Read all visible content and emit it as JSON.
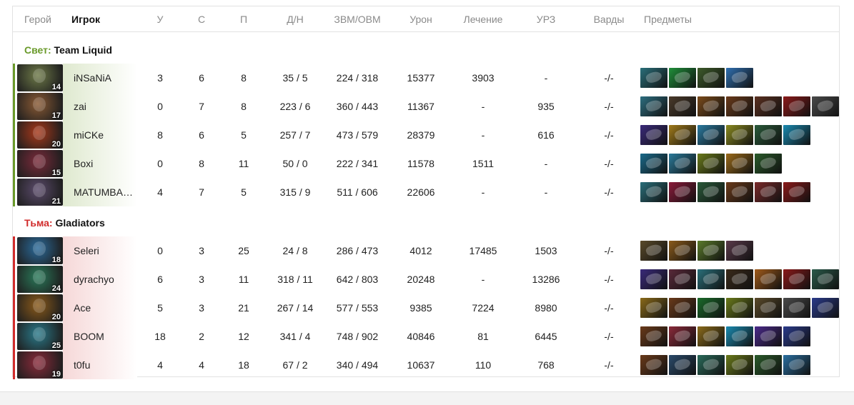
{
  "headers": {
    "hero": "Герой",
    "player": "Игрок",
    "kills": "У",
    "deaths": "С",
    "assists": "П",
    "lh_dn": "Д/Н",
    "gpm_xpm": "ЗВМ/ОВМ",
    "damage": "Урон",
    "healing": "Лечение",
    "tower_damage": "УРЗ",
    "wards": "Варды",
    "items": "Предметы"
  },
  "teams": [
    {
      "side": "Свет:",
      "name": "Team Liquid",
      "players": [
        {
          "level": "14",
          "name": "iNSaNiA",
          "k": "3",
          "d": "6",
          "a": "8",
          "lhdn": "35 / 5",
          "gx": "224 / 318",
          "dmg": "15377",
          "heal": "3903",
          "td": "-",
          "wards": "-/-",
          "hero_color": "#6e7a48",
          "items": [
            "#2a6f7a",
            "#1f8f3a",
            "#3d5a2a",
            "#2f6fb0"
          ]
        },
        {
          "level": "17",
          "name": "zai",
          "k": "0",
          "d": "7",
          "a": "8",
          "lhdn": "223 / 6",
          "gx": "360 / 443",
          "dmg": "11367",
          "heal": "-",
          "td": "935",
          "wards": "-/-",
          "hero_color": "#8a5a34",
          "items": [
            "#2d6e80",
            "#4a3a2a",
            "#7a4a1a",
            "#6a3a1a",
            "#5a3020",
            "#8a1a1a",
            "#4a4a4a"
          ]
        },
        {
          "level": "20",
          "name": "miCKe",
          "k": "8",
          "d": "6",
          "a": "5",
          "lhdn": "257 / 7",
          "gx": "473 / 579",
          "dmg": "28379",
          "heal": "-",
          "td": "616",
          "wards": "-/-",
          "hero_color": "#a8381a",
          "items": [
            "#3a2a7a",
            "#a07a1a",
            "#2a7aa0",
            "#8a8a20",
            "#2a5a3a",
            "#1a8ab0"
          ]
        },
        {
          "level": "15",
          "name": "Boxi",
          "k": "0",
          "d": "8",
          "a": "11",
          "lhdn": "50 / 0",
          "gx": "222 / 341",
          "dmg": "11578",
          "heal": "1511",
          "td": "-",
          "wards": "-/-",
          "hero_color": "#7a2a3a",
          "items": [
            "#1a6a8a",
            "#2a7a9a",
            "#6a7a1a",
            "#9a6a1a",
            "#2a5a2a"
          ]
        },
        {
          "level": "21",
          "name": "MATUMBAM…",
          "k": "4",
          "d": "7",
          "a": "5",
          "lhdn": "315 / 9",
          "gx": "511 / 606",
          "dmg": "22606",
          "heal": "-",
          "td": "-",
          "wards": "-/-",
          "hero_color": "#5a4a6a",
          "items": [
            "#2a6f7a",
            "#8a1a3a",
            "#2a5a3a",
            "#6a3a1a",
            "#7a2a2a",
            "#8a1a1a"
          ]
        }
      ]
    },
    {
      "side": "Тьма:",
      "name": "Gladiators",
      "players": [
        {
          "level": "18",
          "name": "Seleri",
          "k": "0",
          "d": "3",
          "a": "25",
          "lhdn": "24 / 8",
          "gx": "286 / 473",
          "dmg": "4012",
          "heal": "17485",
          "td": "1503",
          "wards": "-/-",
          "hero_color": "#2a6a9a",
          "items": [
            "#5a4a2a",
            "#8a5a1a",
            "#5a7a2a",
            "#5a3a4a"
          ]
        },
        {
          "level": "24",
          "name": "dyrachyo",
          "k": "6",
          "d": "3",
          "a": "11",
          "lhdn": "318 / 11",
          "gx": "642 / 803",
          "dmg": "20248",
          "heal": "-",
          "td": "13286",
          "wards": "-/-",
          "hero_color": "#2a7a5a",
          "items": [
            "#3a2a7a",
            "#5a2a3a",
            "#2a6f7a",
            "#3a2a1a",
            "#a05a1a",
            "#8a1a1a",
            "#2a5a4a"
          ]
        },
        {
          "level": "20",
          "name": "Ace",
          "k": "5",
          "d": "3",
          "a": "21",
          "lhdn": "267 / 14",
          "gx": "577 / 553",
          "dmg": "9385",
          "heal": "7224",
          "td": "8980",
          "wards": "-/-",
          "hero_color": "#8a5a1a",
          "items": [
            "#8a6a1a",
            "#6a3a1a",
            "#1a6a2a",
            "#6a7a1a",
            "#5a4a2a",
            "#4a4a4a",
            "#2a3a8a"
          ]
        },
        {
          "level": "25",
          "name": "BOOM",
          "k": "18",
          "d": "2",
          "a": "12",
          "lhdn": "341 / 4",
          "gx": "748 / 902",
          "dmg": "40846",
          "heal": "81",
          "td": "6445",
          "wards": "-/-",
          "hero_color": "#2a7a8a",
          "items": [
            "#6a3a1a",
            "#8a2a3a",
            "#8a6a1a",
            "#1a8ab0",
            "#4a2a8a",
            "#2a3a8a"
          ]
        },
        {
          "level": "19",
          "name": "t0fu",
          "k": "4",
          "d": "4",
          "a": "18",
          "lhdn": "67 / 2",
          "gx": "340 / 494",
          "dmg": "10637",
          "heal": "110",
          "td": "768",
          "wards": "-/-",
          "hero_color": "#8a2a3a",
          "items": [
            "#6a3a1a",
            "#2a4a6a",
            "#2a6a5a",
            "#6a7a1a",
            "#2a5a2a",
            "#2a6fa0"
          ]
        }
      ]
    }
  ]
}
